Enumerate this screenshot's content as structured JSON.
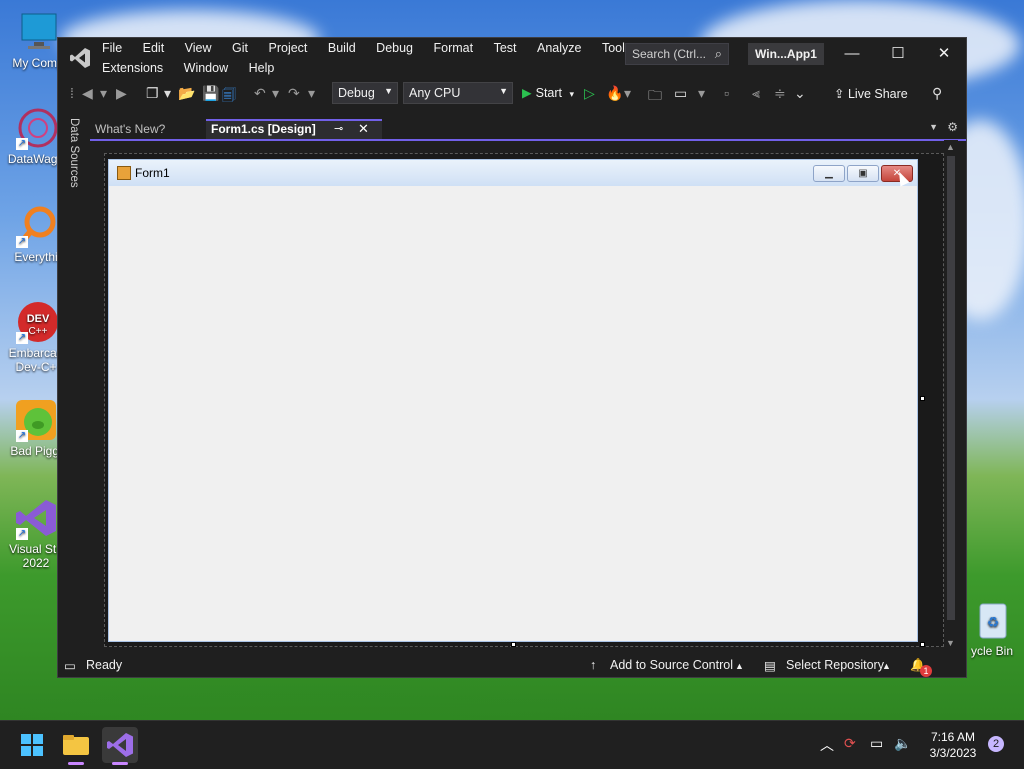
{
  "desktop": {
    "icons": [
      {
        "label": "My Comp"
      },
      {
        "label": "DataWago"
      },
      {
        "label": "Everythi"
      },
      {
        "label": "Embarcad Dev-C+"
      },
      {
        "label": "Bad Piggi"
      },
      {
        "label": "Visual Stu 2022"
      },
      {
        "label": "ycle Bin"
      }
    ]
  },
  "window": {
    "menu": [
      "File",
      "Edit",
      "View",
      "Git",
      "Project",
      "Build",
      "Debug",
      "Format",
      "Test",
      "Analyze",
      "Tools",
      "Extensions",
      "Window",
      "Help"
    ],
    "search_label": "Search (Ctrl...",
    "solution_name": "Win...App1",
    "controls": {
      "minimize": "—",
      "maximize": "☐",
      "close": "✕"
    }
  },
  "toolbar": {
    "config": "Debug",
    "platform": "Any CPU",
    "start_label": "Start",
    "live_share_label": "Live Share"
  },
  "side_panel": {
    "label": "Data Sources"
  },
  "tabs": {
    "inactive": "What's New?",
    "active": "Form1.cs [Design]"
  },
  "form": {
    "title": "Form1"
  },
  "statusbar": {
    "ready": "Ready",
    "add_source_control": "Add to Source Control",
    "select_repository": "Select Repository",
    "notifications_count": "1"
  },
  "taskbar": {
    "time": "7:16 AM",
    "date": "3/3/2023",
    "badge": "2"
  },
  "colors": {
    "accent": "#7160e8",
    "start_green": "#2bc150",
    "form_close": "#c4463c"
  }
}
